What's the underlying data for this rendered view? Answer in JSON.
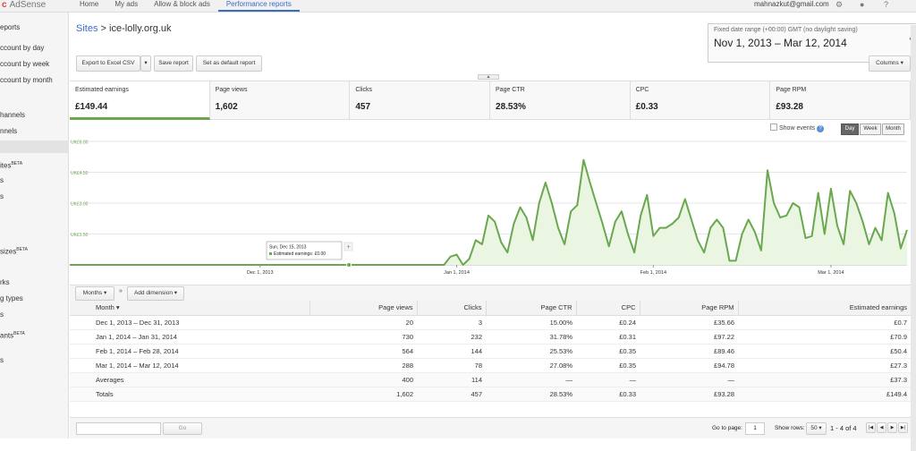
{
  "topbar": {
    "brand": "AdSense",
    "nav": [
      "Home",
      "My ads",
      "Allow & block ads",
      "Performance reports"
    ],
    "active_nav": "Performance reports",
    "account": "mahnazkut@gmail.com",
    "icons": [
      "gear-icon",
      "bell-icon",
      "help-icon"
    ]
  },
  "sidebar": {
    "items": [
      "eports",
      "ccount by day",
      "ccount by week",
      "ccount by month",
      "hannels",
      "nnels",
      "",
      "ites",
      "s",
      "s",
      "",
      "sizes",
      "",
      "rks",
      "g types",
      "s",
      "ants",
      "s"
    ],
    "beta": "BETA"
  },
  "header": {
    "crumb_root": "Sites",
    "crumb_sep": ">",
    "crumb_current": "ice-lolly.org.uk",
    "date_label": "Fixed date range (+00:00) GMT (no daylight saving)",
    "date_value": "Nov 1, 2013 – Mar 12, 2014"
  },
  "toolbar": {
    "export": "Export to Excel CSV",
    "save": "Save report",
    "default": "Set as default report",
    "columns": "Columns"
  },
  "kpis": [
    {
      "label": "Estimated earnings",
      "value": "£149.44"
    },
    {
      "label": "Page views",
      "value": "1,602"
    },
    {
      "label": "Clicks",
      "value": "457"
    },
    {
      "label": "Page CTR",
      "value": "28.53%"
    },
    {
      "label": "CPC",
      "value": "£0.33"
    },
    {
      "label": "Page RPM",
      "value": "£93.28"
    }
  ],
  "chart_controls": {
    "show_events": "Show events",
    "help": "?",
    "day": "Day",
    "week": "Week",
    "month": "Month",
    "active": "Day"
  },
  "chart_data": {
    "type": "area",
    "series_color": "#6aa84f",
    "y_ticks": [
      "UK£6.00",
      "UK£4.50",
      "UK£3.00",
      "UK£1.50"
    ],
    "ylim": [
      0,
      6
    ],
    "x_ticks": [
      "Dec 1, 2013",
      "Jan 1, 2014",
      "Feb 1, 2014",
      "Mar 1, 2014"
    ],
    "start_date": "2013-11-01",
    "values": [
      0,
      0,
      0,
      0,
      0,
      0,
      0,
      0,
      0,
      0,
      0,
      0,
      0,
      0,
      0,
      0,
      0,
      0,
      0,
      0,
      0,
      0,
      0,
      0,
      0,
      0,
      0,
      0,
      0,
      0,
      0,
      0,
      0,
      0,
      0,
      0,
      0,
      0,
      0,
      0,
      0,
      0,
      0,
      0,
      0,
      0,
      0,
      0,
      0,
      0,
      0,
      0,
      0,
      0,
      0,
      0,
      0,
      0,
      0,
      0,
      0.4,
      0.5,
      0,
      0.3,
      1.2,
      1,
      2.4,
      2.1,
      1.1,
      0.6,
      2,
      2.8,
      2.3,
      1.2,
      3,
      4,
      3,
      1.8,
      1,
      2.6,
      2.9,
      5.1,
      4,
      3,
      2,
      0.9,
      2.1,
      2.6,
      1.5,
      0.6,
      2.4,
      3.4,
      1.4,
      1.8,
      1.8,
      2,
      2.3,
      3.2,
      2.2,
      1.2,
      0.6,
      1.8,
      2.2,
      1.8,
      0.2,
      0.2,
      1.5,
      2.2,
      1.6,
      0.7,
      4.6,
      3,
      2.3,
      2.4,
      3,
      2.8,
      1.3,
      1.4,
      3.5,
      1.5,
      3.7,
      1.9,
      1,
      3.6,
      3,
      2.1,
      1,
      1.8,
      1.2,
      3.5,
      2.5,
      0.8,
      1.7
    ],
    "tooltip": {
      "date": "Sun, Dec 15, 2013",
      "label": "Estimated earnings",
      "value": "£0.00",
      "marker": "+"
    }
  },
  "table_controls": {
    "dimension": "Months",
    "add_dimension": "Add dimension"
  },
  "table": {
    "headers": [
      "Month ▾",
      "Page views",
      "Clicks",
      "Page CTR",
      "CPC",
      "Page RPM",
      "Estimated earnings"
    ],
    "rows": [
      [
        "Dec 1, 2013 – Dec 31, 2013",
        "20",
        "3",
        "15.00%",
        "£0.24",
        "£35.66",
        "£0.7"
      ],
      [
        "Jan 1, 2014 – Jan 31, 2014",
        "730",
        "232",
        "31.78%",
        "£0.31",
        "£97.22",
        "£70.9"
      ],
      [
        "Feb 1, 2014 – Feb 28, 2014",
        "564",
        "144",
        "25.53%",
        "£0.35",
        "£89.46",
        "£50.4"
      ],
      [
        "Mar 1, 2014 – Mar 12, 2014",
        "288",
        "78",
        "27.08%",
        "£0.35",
        "£94.78",
        "£27.3"
      ]
    ],
    "averages": [
      "Averages",
      "400",
      "114",
      "—",
      "—",
      "—",
      "£37.3"
    ],
    "totals": [
      "Totals",
      "1,602",
      "457",
      "28.53%",
      "£0.33",
      "£93.28",
      "£149.4"
    ]
  },
  "footer": {
    "go": "Go",
    "go_to_page": "Go to page:",
    "page": "1",
    "show_rows": "Show rows:",
    "rows": "50",
    "range": "1 - 4 of 4"
  }
}
